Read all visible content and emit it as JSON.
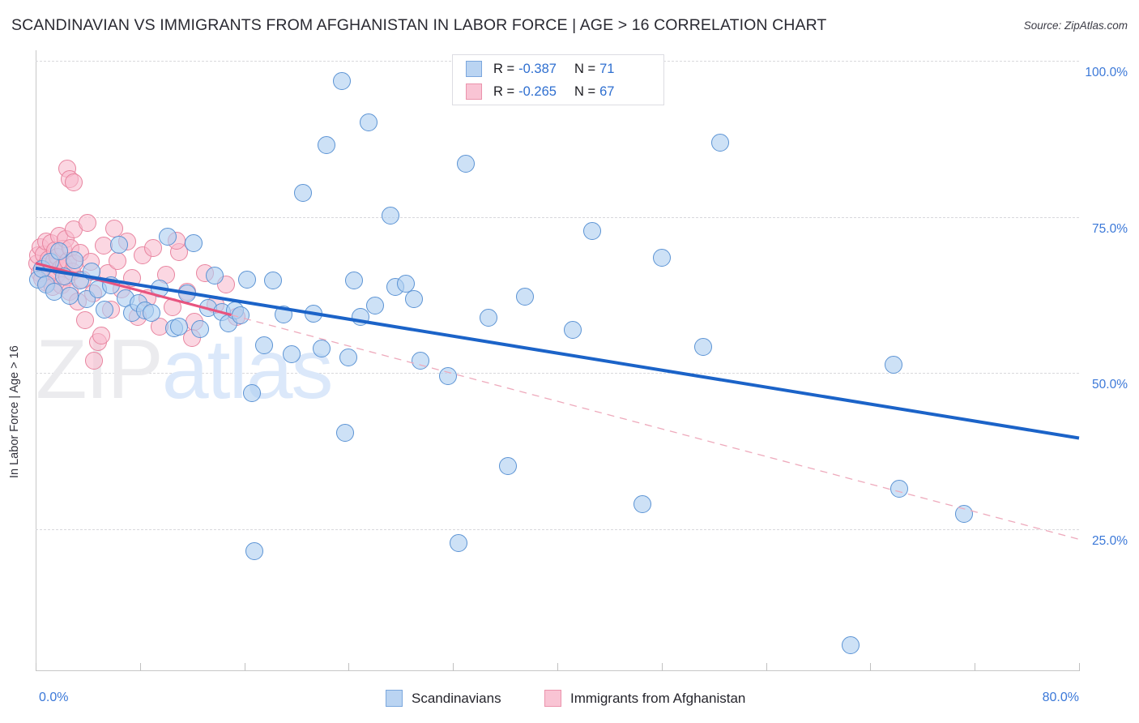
{
  "header": {
    "title": "SCANDINAVIAN VS IMMIGRANTS FROM AFGHANISTAN IN LABOR FORCE | AGE > 16 CORRELATION CHART",
    "source": "Source: ZipAtlas.com"
  },
  "watermark": {
    "part1": "ZIP",
    "part2": "atlas"
  },
  "stats": {
    "blue": {
      "r_label": "R =",
      "r_value": "-0.387",
      "n_label": "N =",
      "n_value": "71"
    },
    "pink": {
      "r_label": "R =",
      "r_value": "-0.265",
      "n_label": "N =",
      "n_value": "67"
    }
  },
  "legend": {
    "blue_label": "Scandinavians",
    "pink_label": "Immigrants from Afghanistan"
  },
  "chart_data": {
    "type": "scatter",
    "title": "SCANDINAVIAN VS IMMIGRANTS FROM AFGHANISTAN IN LABOR FORCE | AGE > 16 CORRELATION CHART",
    "xlabel": "",
    "ylabel": "In Labor Force | Age > 16",
    "xlim": [
      0,
      80
    ],
    "ylim": [
      0,
      107.5
    ],
    "grid": true,
    "legend_position": "bottom-center",
    "x_tick_labels": [
      "0.0%",
      "80.0%"
    ],
    "y_tick_labels": [
      "100.0%",
      "75.0%",
      "50.0%",
      "25.0%"
    ],
    "y_ticks": [
      100,
      75,
      50,
      25
    ],
    "x_ticks": [
      0,
      8,
      16,
      24,
      32,
      40,
      48,
      56,
      64,
      72,
      80
    ],
    "colors": {
      "blue_fill": "#afcef1",
      "blue_stroke": "#5b93d4",
      "pink_fill": "#f8bacd",
      "pink_stroke": "#e8849f",
      "blue_trend": "#1b63c8",
      "pink_trend": "#e8547f",
      "tick_text": "#3b78d8"
    },
    "series": [
      {
        "name": "Scandinavians",
        "r": -0.387,
        "n": 71,
        "trend": {
          "x0": 0,
          "y0": 66.8,
          "x1": 80,
          "y1": 39.6,
          "style": "solid"
        },
        "points": [
          [
            0.2,
            65.0
          ],
          [
            0.5,
            66.6
          ],
          [
            0.8,
            64.2
          ],
          [
            1.1,
            67.8
          ],
          [
            1.4,
            63.0
          ],
          [
            1.8,
            69.5
          ],
          [
            2.2,
            65.5
          ],
          [
            2.6,
            62.4
          ],
          [
            3.0,
            68.1
          ],
          [
            3.4,
            64.8
          ],
          [
            3.9,
            61.9
          ],
          [
            4.3,
            66.2
          ],
          [
            4.8,
            63.4
          ],
          [
            5.3,
            60.2
          ],
          [
            5.8,
            64.0
          ],
          [
            6.4,
            70.5
          ],
          [
            6.9,
            62.0
          ],
          [
            7.4,
            59.6
          ],
          [
            7.9,
            61.2
          ],
          [
            8.4,
            60.0
          ],
          [
            8.9,
            59.7
          ],
          [
            9.5,
            63.5
          ],
          [
            10.1,
            71.8
          ],
          [
            10.6,
            57.2
          ],
          [
            11.0,
            57.4
          ],
          [
            11.6,
            62.8
          ],
          [
            12.1,
            70.8
          ],
          [
            12.6,
            57.1
          ],
          [
            13.2,
            60.4
          ],
          [
            13.7,
            65.6
          ],
          [
            14.3,
            59.8
          ],
          [
            14.8,
            58.0
          ],
          [
            15.3,
            60.0
          ],
          [
            15.7,
            59.2
          ],
          [
            16.2,
            65.0
          ],
          [
            16.6,
            46.8
          ],
          [
            16.8,
            21.5
          ],
          [
            17.5,
            54.5
          ],
          [
            18.2,
            64.8
          ],
          [
            19.0,
            59.4
          ],
          [
            19.6,
            53.0
          ],
          [
            20.5,
            78.8
          ],
          [
            21.3,
            59.5
          ],
          [
            21.9,
            54.0
          ],
          [
            22.3,
            86.5
          ],
          [
            23.5,
            96.8
          ],
          [
            23.7,
            40.4
          ],
          [
            24.0,
            52.5
          ],
          [
            24.4,
            64.8
          ],
          [
            24.9,
            59.0
          ],
          [
            25.5,
            90.2
          ],
          [
            26.0,
            60.8
          ],
          [
            27.2,
            75.2
          ],
          [
            27.6,
            63.8
          ],
          [
            28.4,
            64.3
          ],
          [
            29.0,
            61.8
          ],
          [
            29.5,
            52.0
          ],
          [
            31.6,
            49.5
          ],
          [
            32.4,
            22.8
          ],
          [
            33.0,
            83.5
          ],
          [
            34.7,
            58.9
          ],
          [
            36.2,
            35.1
          ],
          [
            37.5,
            62.2
          ],
          [
            41.2,
            56.9
          ],
          [
            42.7,
            72.8
          ],
          [
            46.5,
            29.0
          ],
          [
            48.0,
            68.5
          ],
          [
            51.2,
            54.2
          ],
          [
            52.5,
            86.9
          ],
          [
            65.8,
            51.3
          ],
          [
            66.2,
            31.5
          ],
          [
            62.5,
            6.5
          ],
          [
            71.2,
            27.5
          ]
        ]
      },
      {
        "name": "Immigrants from Afghanistan",
        "r": -0.265,
        "n": 67,
        "trend": {
          "x0": 0,
          "y0": 67.6,
          "x1": 80,
          "y1": 23.4,
          "style": "solid-then-dashed",
          "solid_until_x": 15.0
        },
        "points": [
          [
            0.1,
            67.5
          ],
          [
            0.2,
            68.9
          ],
          [
            0.3,
            66.0
          ],
          [
            0.4,
            70.2
          ],
          [
            0.5,
            65.1
          ],
          [
            0.6,
            69.0
          ],
          [
            0.7,
            67.0
          ],
          [
            0.8,
            71.0
          ],
          [
            0.9,
            64.5
          ],
          [
            1.0,
            68.2
          ],
          [
            1.1,
            66.4
          ],
          [
            1.2,
            70.8
          ],
          [
            1.3,
            63.8
          ],
          [
            1.4,
            67.9
          ],
          [
            1.5,
            69.6
          ],
          [
            1.6,
            65.8
          ],
          [
            1.7,
            68.6
          ],
          [
            1.8,
            72.0
          ],
          [
            1.9,
            66.8
          ],
          [
            2.0,
            64.0
          ],
          [
            2.1,
            69.9
          ],
          [
            2.2,
            67.2
          ],
          [
            2.3,
            71.5
          ],
          [
            2.4,
            65.4
          ],
          [
            2.5,
            68.0
          ],
          [
            2.6,
            63.0
          ],
          [
            2.7,
            70.0
          ],
          [
            2.8,
            66.2
          ],
          [
            2.9,
            73.0
          ],
          [
            3.0,
            67.6
          ],
          [
            3.2,
            61.5
          ],
          [
            3.4,
            69.2
          ],
          [
            3.6,
            65.0
          ],
          [
            3.8,
            58.5
          ],
          [
            2.4,
            82.8
          ],
          [
            2.6,
            81.0
          ],
          [
            2.9,
            80.6
          ],
          [
            4.0,
            74.0
          ],
          [
            4.2,
            67.8
          ],
          [
            4.4,
            62.8
          ],
          [
            4.8,
            55.0
          ],
          [
            5.0,
            56.0
          ],
          [
            5.2,
            70.4
          ],
          [
            5.5,
            66.0
          ],
          [
            5.8,
            60.2
          ],
          [
            6.0,
            73.2
          ],
          [
            6.3,
            68.0
          ],
          [
            6.6,
            63.4
          ],
          [
            4.5,
            52.0
          ],
          [
            7.0,
            71.0
          ],
          [
            7.4,
            65.2
          ],
          [
            7.8,
            59.0
          ],
          [
            8.2,
            68.8
          ],
          [
            8.6,
            62.0
          ],
          [
            9.0,
            70.0
          ],
          [
            9.5,
            57.4
          ],
          [
            10.0,
            65.8
          ],
          [
            10.5,
            60.5
          ],
          [
            11.0,
            69.4
          ],
          [
            11.6,
            63.0
          ],
          [
            12.2,
            58.2
          ],
          [
            13.0,
            66.0
          ],
          [
            13.8,
            61.0
          ],
          [
            14.6,
            64.2
          ],
          [
            15.4,
            59.0
          ],
          [
            10.8,
            71.2
          ],
          [
            12.0,
            55.6
          ]
        ]
      }
    ]
  }
}
